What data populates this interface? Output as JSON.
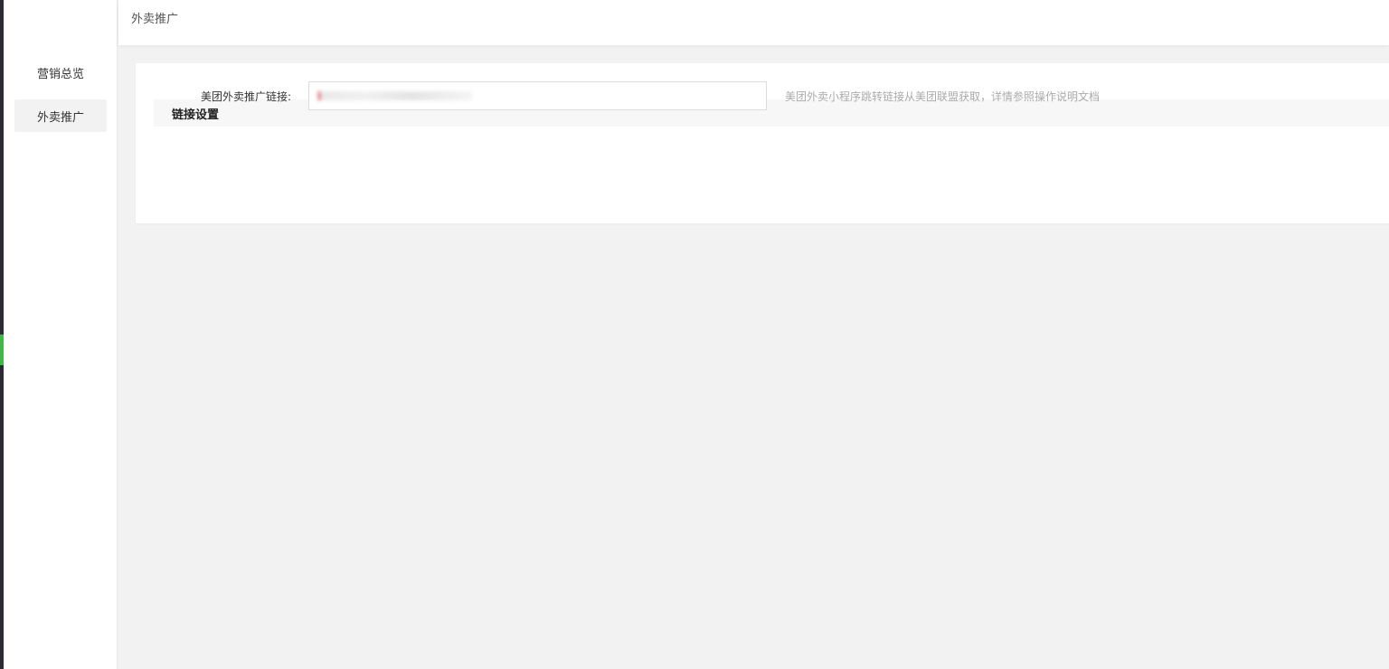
{
  "sidebar": {
    "items": [
      {
        "label": "营销总览"
      },
      {
        "label": "外卖推广"
      }
    ]
  },
  "header": {
    "breadcrumb": "外卖推广"
  },
  "main": {
    "section_title": "链接设置",
    "form": {
      "link_label": "美团外卖推广链接:",
      "link_value": "",
      "help_text": "美团外卖小程序跳转链接从美团联盟获取，详情参照操作说明文档"
    }
  },
  "colors": {
    "accent": "#44b549",
    "left_strip": "#2b2b36"
  }
}
